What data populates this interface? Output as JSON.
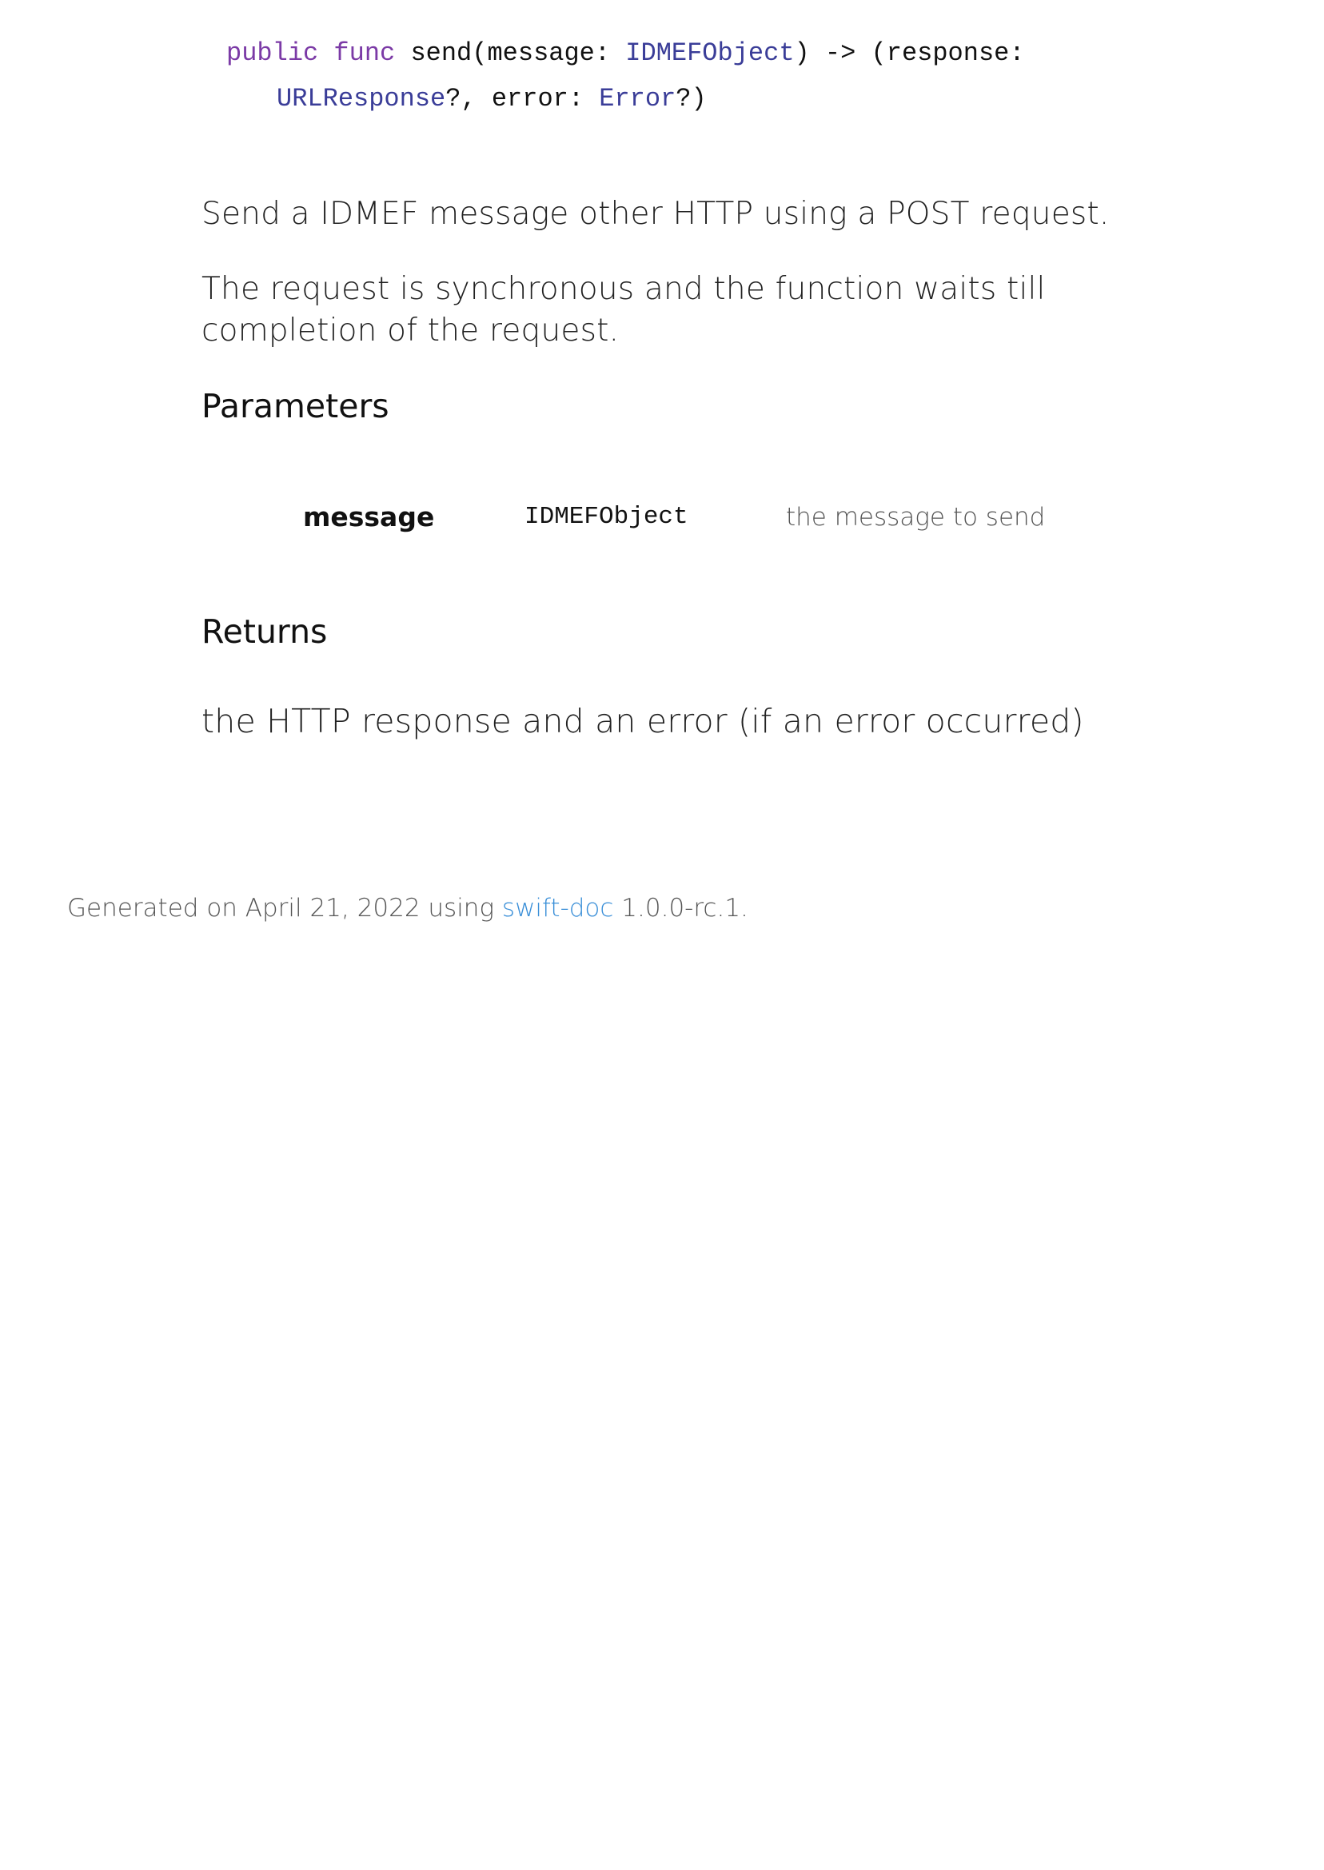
{
  "declaration": {
    "kw_public": "public",
    "kw_func": "func",
    "sig_name": " send(message: ",
    "type_message": "IDMEFObject",
    "sig_mid": ") -> (response:",
    "type_response": "URLResponse",
    "sig_mid2": "?, error: ",
    "type_error": "Error",
    "sig_end": "?)"
  },
  "description": {
    "p1": "Send a IDMEF message other HTTP using a POST request.",
    "p2": "The request is synchronous and the function waits till completion of the request."
  },
  "parameters": {
    "heading": "Parameters",
    "items": [
      {
        "name": "message",
        "type": "IDMEFObject",
        "description": "the message to send"
      }
    ]
  },
  "returns": {
    "heading": "Returns",
    "text": "the HTTP response and an error (if an error occurred)"
  },
  "footer": {
    "prefix": "Generated on April 21, 2022 using ",
    "link_label": "swift-doc",
    "suffix": " 1.0.0-rc.1."
  },
  "colors": {
    "keyword": "#7b3aa6",
    "type": "#3a3d98",
    "link": "#3a8fd8"
  }
}
